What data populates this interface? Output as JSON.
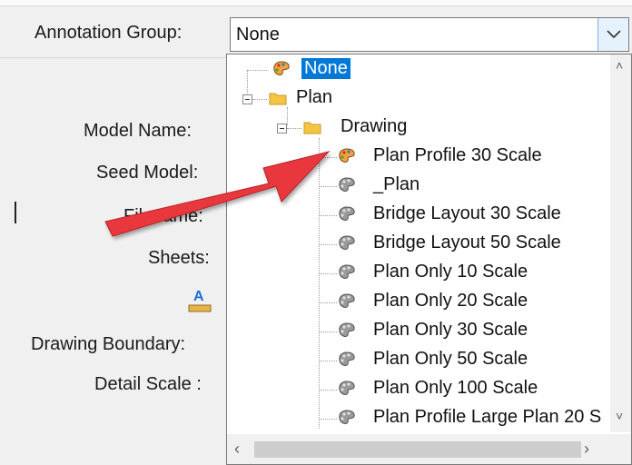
{
  "form": {
    "annotation_group_label": "Annotation Group:",
    "model_name_label": "Model Name:",
    "seed_model_label": "Seed Model:",
    "filename_label": "Filename:",
    "sheets_label": "Sheets:",
    "drawing_boundary_label": "Drawing Boundary:",
    "detail_scale_label": "Detail Scale :"
  },
  "combo": {
    "value": "None"
  },
  "tree": {
    "none": "None",
    "plan": "Plan",
    "drawing": "Drawing",
    "items": [
      "Plan Profile 30 Scale",
      "_Plan",
      "Bridge Layout 30 Scale",
      "Bridge Layout 50 Scale",
      "Plan Only 10 Scale",
      "Plan Only 20 Scale",
      "Plan Only 30 Scale",
      "Plan Only 50 Scale",
      "Plan Only 100 Scale",
      "Plan Profile Large Plan 20 S"
    ]
  },
  "icons": {
    "palette": "palette-icon",
    "folder": "folder-icon",
    "text_style": "text-style-icon"
  },
  "colors": {
    "selection": "#0078d7",
    "arrow": "#e8383d",
    "folder": "#f5c542"
  }
}
